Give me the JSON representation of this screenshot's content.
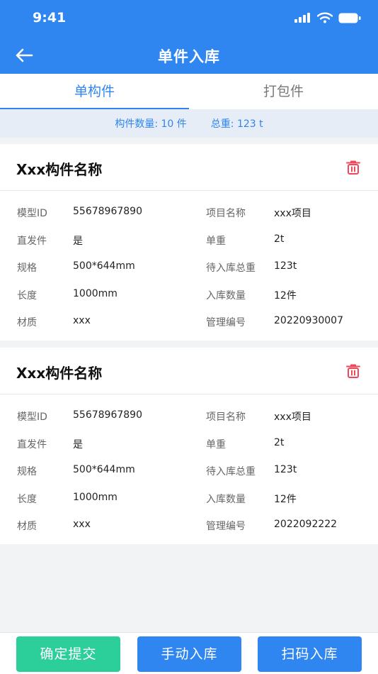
{
  "status_bar": {
    "time": "9:41"
  },
  "nav": {
    "title": "单件入库"
  },
  "tabs": [
    {
      "label": "单构件",
      "active": true
    },
    {
      "label": "打包件",
      "active": false
    }
  ],
  "summary": {
    "count_text": "构件数量: 10 件",
    "weight_text": "总重: 123 t"
  },
  "cards": [
    {
      "title": "Xxx构件名称",
      "left_fields": [
        {
          "label": "模型ID",
          "value": "55678967890"
        },
        {
          "label": "直发件",
          "value": "是"
        },
        {
          "label": "规格",
          "value": "500*644mm"
        },
        {
          "label": "长度",
          "value": "1000mm"
        },
        {
          "label": "材质",
          "value": "xxx"
        }
      ],
      "right_fields": [
        {
          "label": "项目名称",
          "value": "xxx项目"
        },
        {
          "label": "单重",
          "value": "2t"
        },
        {
          "label": "待入库总重",
          "value": "123t"
        },
        {
          "label": "入库数量",
          "value": "12件"
        },
        {
          "label": "管理编号",
          "value": "20220930007"
        }
      ]
    },
    {
      "title": "Xxx构件名称",
      "left_fields": [
        {
          "label": "模型ID",
          "value": "55678967890"
        },
        {
          "label": "直发件",
          "value": "是"
        },
        {
          "label": "规格",
          "value": "500*644mm"
        },
        {
          "label": "长度",
          "value": "1000mm"
        },
        {
          "label": "材质",
          "value": "xxx"
        }
      ],
      "right_fields": [
        {
          "label": "项目名称",
          "value": "xxx项目"
        },
        {
          "label": "单重",
          "value": "2t"
        },
        {
          "label": "待入库总重",
          "value": "123t"
        },
        {
          "label": "入库数量",
          "value": "12件"
        },
        {
          "label": "管理编号",
          "value": "2022092222"
        }
      ]
    }
  ],
  "footer": {
    "confirm_label": "确定提交",
    "manual_label": "手动入库",
    "scan_label": "扫码入库"
  },
  "colors": {
    "primary": "#2f86f0",
    "confirm": "#2ccf9a",
    "delete": "#f0475a"
  }
}
